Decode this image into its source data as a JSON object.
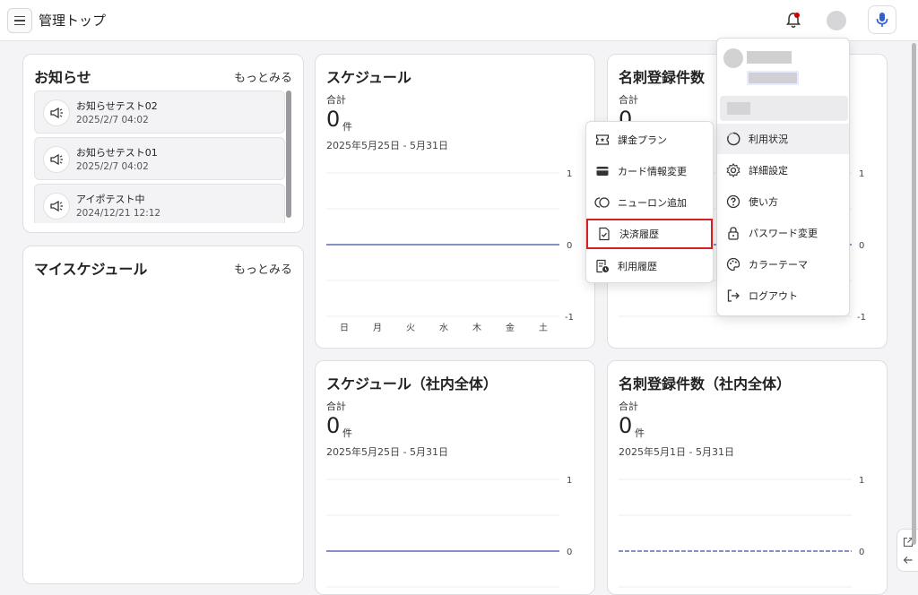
{
  "header": {
    "title": "管理トップ"
  },
  "news": {
    "title": "お知らせ",
    "more": "もっとみる",
    "items": [
      {
        "title": "お知らせテスト02",
        "date": "2025/2/7 04:02"
      },
      {
        "title": "お知らせテスト01",
        "date": "2025/2/7 04:02"
      },
      {
        "title": "アイポテスト中",
        "date": "2024/12/21 12:12"
      }
    ]
  },
  "my_schedule": {
    "title": "マイスケジュール",
    "more": "もっとみる"
  },
  "schedule": {
    "title": "スケジュール",
    "total_label": "合計",
    "count": "0",
    "unit": "件",
    "range": "2025年5月25日 - 5月31日"
  },
  "cards": {
    "title": "名刺登録件数",
    "total_label": "合計",
    "count": "0"
  },
  "schedule_all": {
    "title": "スケジュール（社内全体）",
    "total_label": "合計",
    "count": "0",
    "unit": "件",
    "range": "2025年5月25日 - 5月31日"
  },
  "cards_all": {
    "title": "名刺登録件数（社内全体）",
    "total_label": "合計",
    "count": "0",
    "unit": "件",
    "range": "2025年5月1日 - 5月31日"
  },
  "chart_axis": {
    "top": "1",
    "zero": "0",
    "bottom": "-1"
  },
  "weekdays": [
    "日",
    "月",
    "火",
    "水",
    "木",
    "金",
    "土"
  ],
  "billing_menu": {
    "items": [
      {
        "label": "課金プラン",
        "icon": "ticket-icon"
      },
      {
        "label": "カード情報変更",
        "icon": "card-icon"
      },
      {
        "label": "ニューロン追加",
        "icon": "neuron-icon"
      },
      {
        "label": "決済履歴",
        "icon": "receipt-check-icon"
      },
      {
        "label": "利用履歴",
        "icon": "history-icon"
      }
    ]
  },
  "account_menu": {
    "items": [
      {
        "label": "利用状況",
        "icon": "usage-icon"
      },
      {
        "label": "詳細設定",
        "icon": "gear-icon"
      },
      {
        "label": "使い方",
        "icon": "help-icon"
      },
      {
        "label": "パスワード変更",
        "icon": "lock-icon"
      },
      {
        "label": "カラーテーマ",
        "icon": "palette-icon"
      },
      {
        "label": "ログアウト",
        "icon": "logout-icon"
      }
    ]
  },
  "chart_data": [
    {
      "type": "line",
      "title": "スケジュール",
      "categories": [
        "日",
        "月",
        "火",
        "水",
        "木",
        "金",
        "土"
      ],
      "series": [
        {
          "values": [
            0,
            0,
            0,
            0,
            0,
            0,
            0
          ]
        }
      ],
      "ylim": [
        -1,
        1
      ]
    },
    {
      "type": "line",
      "title": "名刺登録件数",
      "series": [
        {
          "values": [
            0,
            0,
            0,
            0,
            0,
            0,
            0
          ]
        }
      ],
      "ylim": [
        -1,
        1
      ]
    },
    {
      "type": "line",
      "title": "スケジュール（社内全体）",
      "series": [
        {
          "values": [
            0,
            0,
            0,
            0,
            0,
            0,
            0
          ]
        }
      ],
      "ylim": [
        -1,
        1
      ]
    },
    {
      "type": "line",
      "title": "名刺登録件数（社内全体）",
      "series": [
        {
          "values": [
            0,
            0,
            0,
            0,
            0,
            0,
            0,
            0,
            0,
            0,
            0,
            0,
            0,
            0,
            0,
            0,
            0,
            0,
            0,
            0,
            0,
            0,
            0,
            0,
            0,
            0,
            0,
            0,
            0,
            0,
            0
          ]
        }
      ],
      "ylim": [
        -1,
        1
      ]
    }
  ]
}
